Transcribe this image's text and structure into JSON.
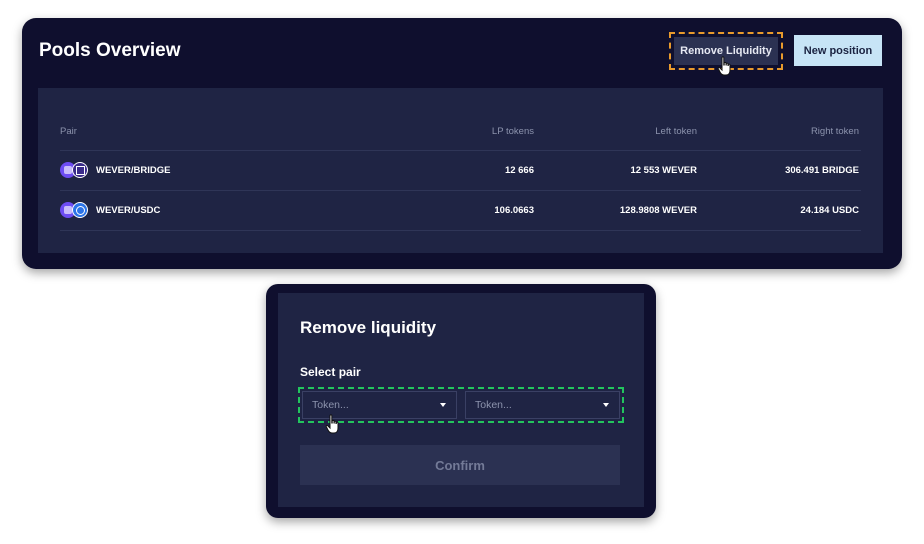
{
  "overview": {
    "title": "Pools Overview",
    "remove_button": "Remove Liquidity",
    "new_button": "New position"
  },
  "table": {
    "headers": {
      "pair": "Pair",
      "lp": "LP tokens",
      "left": "Left token",
      "right": "Right token"
    },
    "rows": [
      {
        "pair": "WEVER/BRIDGE",
        "lp": "12 666",
        "left": "12 553 WEVER",
        "right": "306.491 BRIDGE",
        "icons": [
          "wever-token-icon",
          "bridge-token-icon"
        ]
      },
      {
        "pair": "WEVER/USDC",
        "lp": "106.0663",
        "left": "128.9808 WEVER",
        "right": "24.184 USDC",
        "icons": [
          "wever-token-icon",
          "usdc-token-icon"
        ]
      }
    ]
  },
  "modal": {
    "title": "Remove liquidity",
    "select_label": "Select pair",
    "left_select": {
      "placeholder": "Token..."
    },
    "right_select": {
      "placeholder": "Token..."
    },
    "confirm_button": "Confirm"
  },
  "colors": {
    "card_bg": "#0f0f2e",
    "panel_bg": "#1f2444",
    "highlight_orange": "#e89a2c",
    "highlight_green": "#22c55e",
    "new_button_bg": "#c7e4f6"
  }
}
